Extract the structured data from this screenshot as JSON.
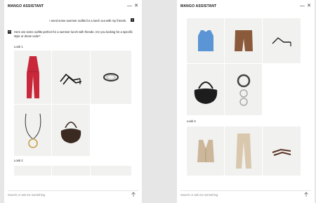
{
  "left": {
    "title": "MANGO ASSISTANT",
    "user_message": "I need some summer outfits for a lunch out with my friends.",
    "assistant_message": "Here are some outfits perfect for a summer lunch with friends. Are you looking for a specific style or dress code?",
    "look1_label": "Look 1",
    "look2_label": "Look 2",
    "search_placeholder": "Search or ask me something"
  },
  "right": {
    "title": "MANGO ASSISTANT",
    "look3_label": "Look 3",
    "search_placeholder": "Search or ask me something"
  },
  "icons": {
    "minimize": "minimize-icon",
    "close": "close-icon",
    "send": "arrow-up-icon"
  },
  "colors": {
    "tile_bg": "#f1f1f0",
    "jumpsuit": "#c8283a",
    "vest_blue": "#5b95d6",
    "shorts_brown": "#8a5a3a",
    "bag_black": "#1d1d1d",
    "beige": "#cdb79a"
  }
}
